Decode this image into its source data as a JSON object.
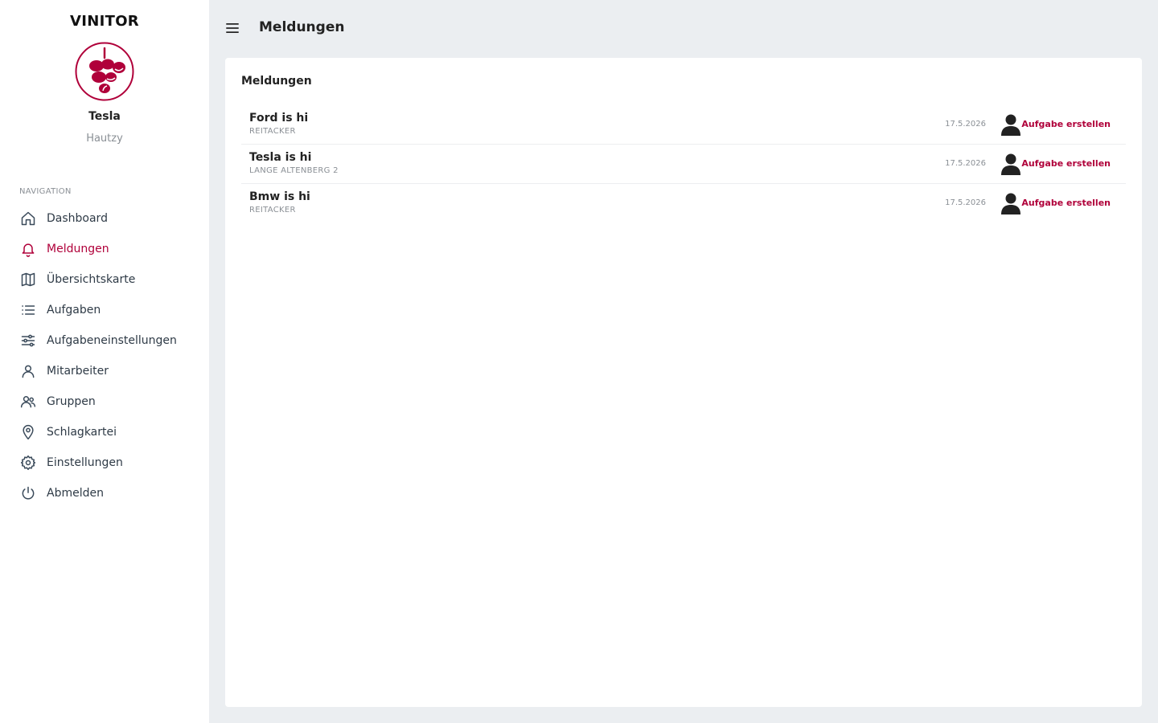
{
  "app": {
    "brand": "VINITOR"
  },
  "user": {
    "name": "Tesla",
    "subtitle": "Hautzy"
  },
  "sidebar": {
    "section_label": "NAVIGATION",
    "items": [
      {
        "label": "Dashboard",
        "icon": "home-icon"
      },
      {
        "label": "Meldungen",
        "icon": "bell-icon",
        "active": true
      },
      {
        "label": "Übersichtskarte",
        "icon": "map-icon"
      },
      {
        "label": "Aufgaben",
        "icon": "list-icon"
      },
      {
        "label": "Aufgabeneinstellungen",
        "icon": "sliders-icon"
      },
      {
        "label": "Mitarbeiter",
        "icon": "user-icon"
      },
      {
        "label": "Gruppen",
        "icon": "users-icon"
      },
      {
        "label": "Schlagkartei",
        "icon": "map-pin-icon"
      },
      {
        "label": "Einstellungen",
        "icon": "gear-icon"
      },
      {
        "label": "Abmelden",
        "icon": "power-icon"
      }
    ]
  },
  "header": {
    "title": "Meldungen"
  },
  "card": {
    "title": "Meldungen",
    "rows": [
      {
        "title": "Ford is hi",
        "subtitle": "REITACKER",
        "date": "17.5.2026",
        "action": "Aufgabe erstellen"
      },
      {
        "title": "Tesla is hi",
        "subtitle": "LANGE ALTENBERG 2",
        "date": "17.5.2026",
        "action": "Aufgabe erstellen"
      },
      {
        "title": "Bmw is hi",
        "subtitle": "REITACKER",
        "date": "17.5.2026",
        "action": "Aufgabe erstellen"
      }
    ]
  },
  "colors": {
    "accent": "#b0003a",
    "background": "#ebeef1",
    "muted": "#8a8f95"
  }
}
